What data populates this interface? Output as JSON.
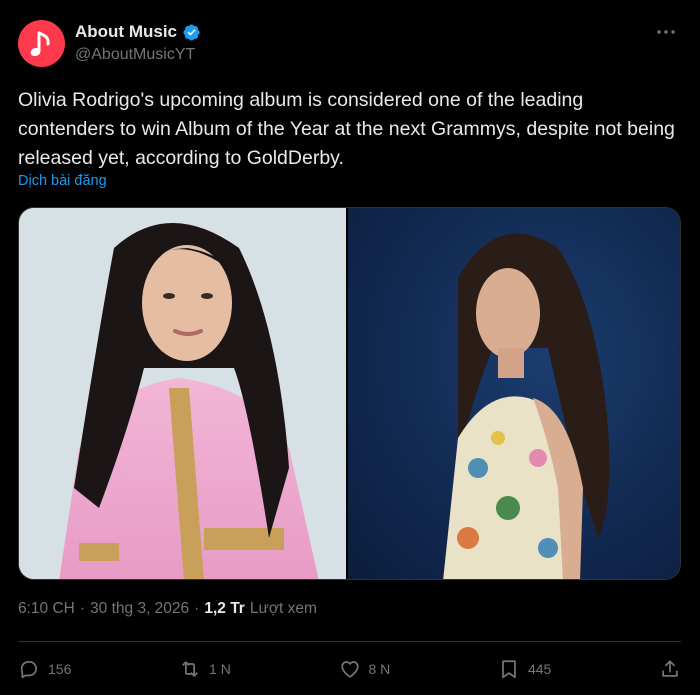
{
  "author": {
    "name": "About Music",
    "handle": "@AboutMusicYT",
    "avatar_color": "#ff3a4c",
    "verified_color": "#1d9bf0"
  },
  "more_icon": "more-horizontal-icon",
  "text": "Olivia Rodrigo's upcoming album is considered one of the leading contenders to win Album of the Year at the next Grammys, despite not being released yet, according to GoldDerby.",
  "translate_label": "Dịch bài đăng",
  "meta": {
    "time": "6:10 CH",
    "sep1": "·",
    "date": "30 thg 3, 2026",
    "sep2": "·",
    "views_count": "1,2 Tr",
    "views_label": "Lượt xem"
  },
  "actions": {
    "reply_count": "156",
    "repost_count": "1 N",
    "like_count": "8 N",
    "bookmark_count": "445"
  },
  "colors": {
    "background": "#000000",
    "text": "#e7e9ea",
    "secondary": "#71767b",
    "link": "#1d9bf0"
  }
}
